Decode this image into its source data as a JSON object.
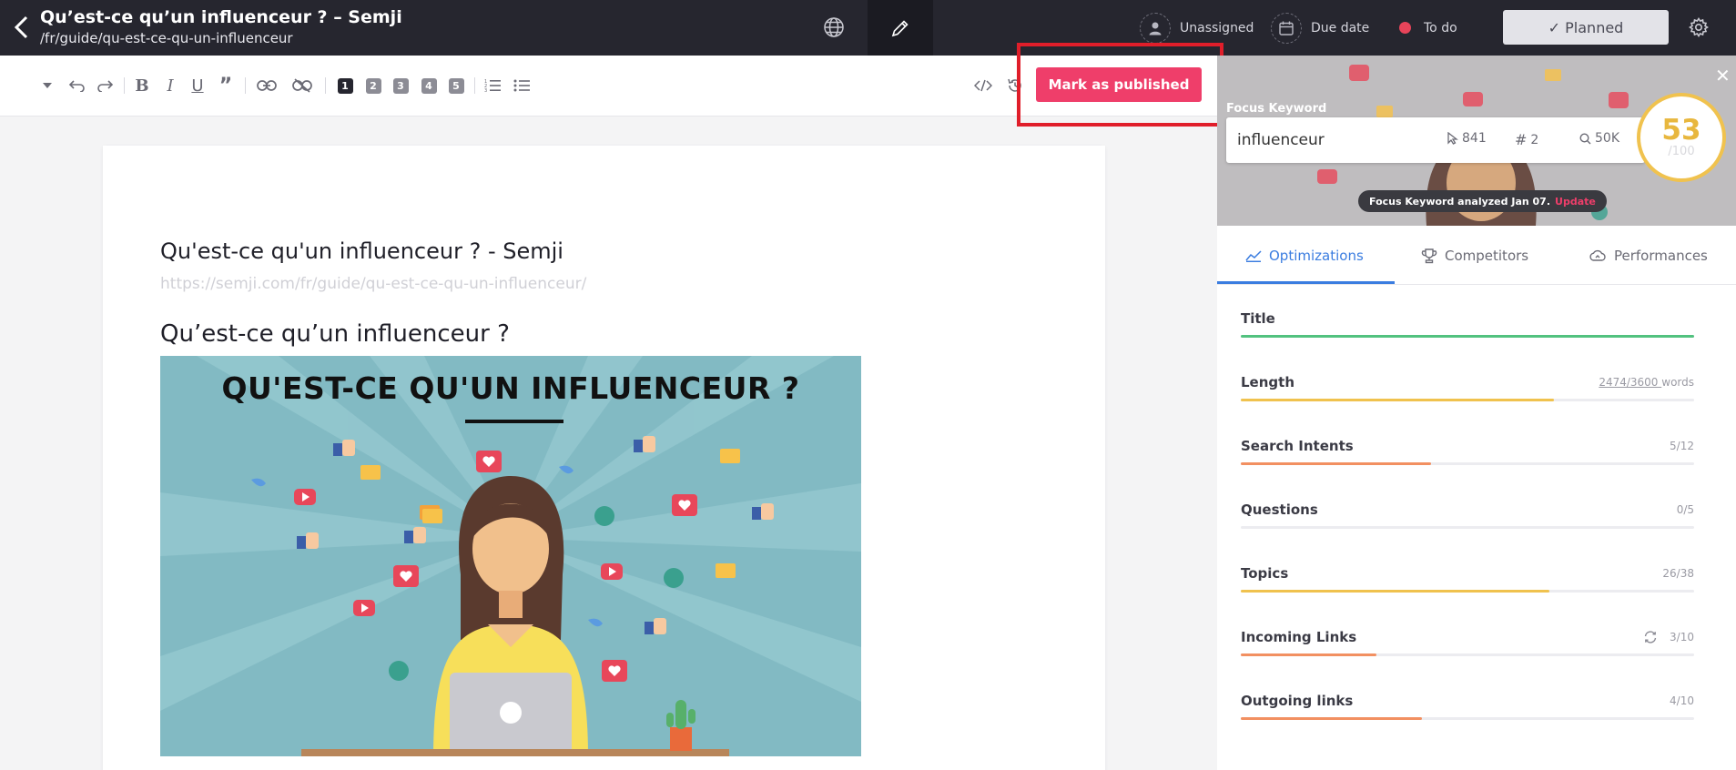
{
  "topbar": {
    "title": "Qu’est-ce qu’un influenceur ? – Semji",
    "path": "/fr/guide/qu-est-ce-qu-un-influenceur",
    "assignee": "Unassigned",
    "due_date": "Due date",
    "status": "To do",
    "status_color": "#e8445a",
    "planned_label": "✓ Planned"
  },
  "toolbar": {
    "publish_label": "Mark as published",
    "heading_levels": [
      "1",
      "2",
      "3",
      "4",
      "5"
    ]
  },
  "editor": {
    "seo_title": "Qu'est-ce qu'un influenceur ? - Semji",
    "seo_url": "https://semji.com/fr/guide/qu-est-ce-qu-un-influenceur/",
    "h1": "Qu’est-ce qu’un influenceur ?",
    "hero_title": "QU'EST-CE QU'UN INFLUENCEUR ?"
  },
  "panel": {
    "focus_label": "Focus Keyword",
    "keyword": "influenceur",
    "clicks": "841",
    "rank": "2",
    "volume": "50K",
    "score": "53",
    "score_max": "/100",
    "analyzed_text": "Focus Keyword analyzed Jan 07.",
    "update_label": "Update",
    "tabs": [
      "Optimizations",
      "Competitors",
      "Performances"
    ],
    "metrics": [
      {
        "label": "Title",
        "value": "",
        "fraction": 1.0,
        "color": "#52c27f"
      },
      {
        "label": "Length",
        "value_main": "2474/3600 ",
        "value_unit": "words",
        "fraction": 0.69,
        "color": "#f0c24e"
      },
      {
        "label": "Search Intents",
        "value": "5/12",
        "fraction": 0.42,
        "color": "#f29061"
      },
      {
        "label": "Questions",
        "value": "0/5",
        "fraction": 0.0,
        "color": "#f29061"
      },
      {
        "label": "Topics",
        "value": "26/38",
        "fraction": 0.68,
        "color": "#f0c24e"
      },
      {
        "label": "Incoming Links",
        "value": "3/10",
        "fraction": 0.3,
        "color": "#f29061"
      },
      {
        "label": "Outgoing links",
        "value": "4/10",
        "fraction": 0.4,
        "color": "#f29061"
      }
    ]
  }
}
